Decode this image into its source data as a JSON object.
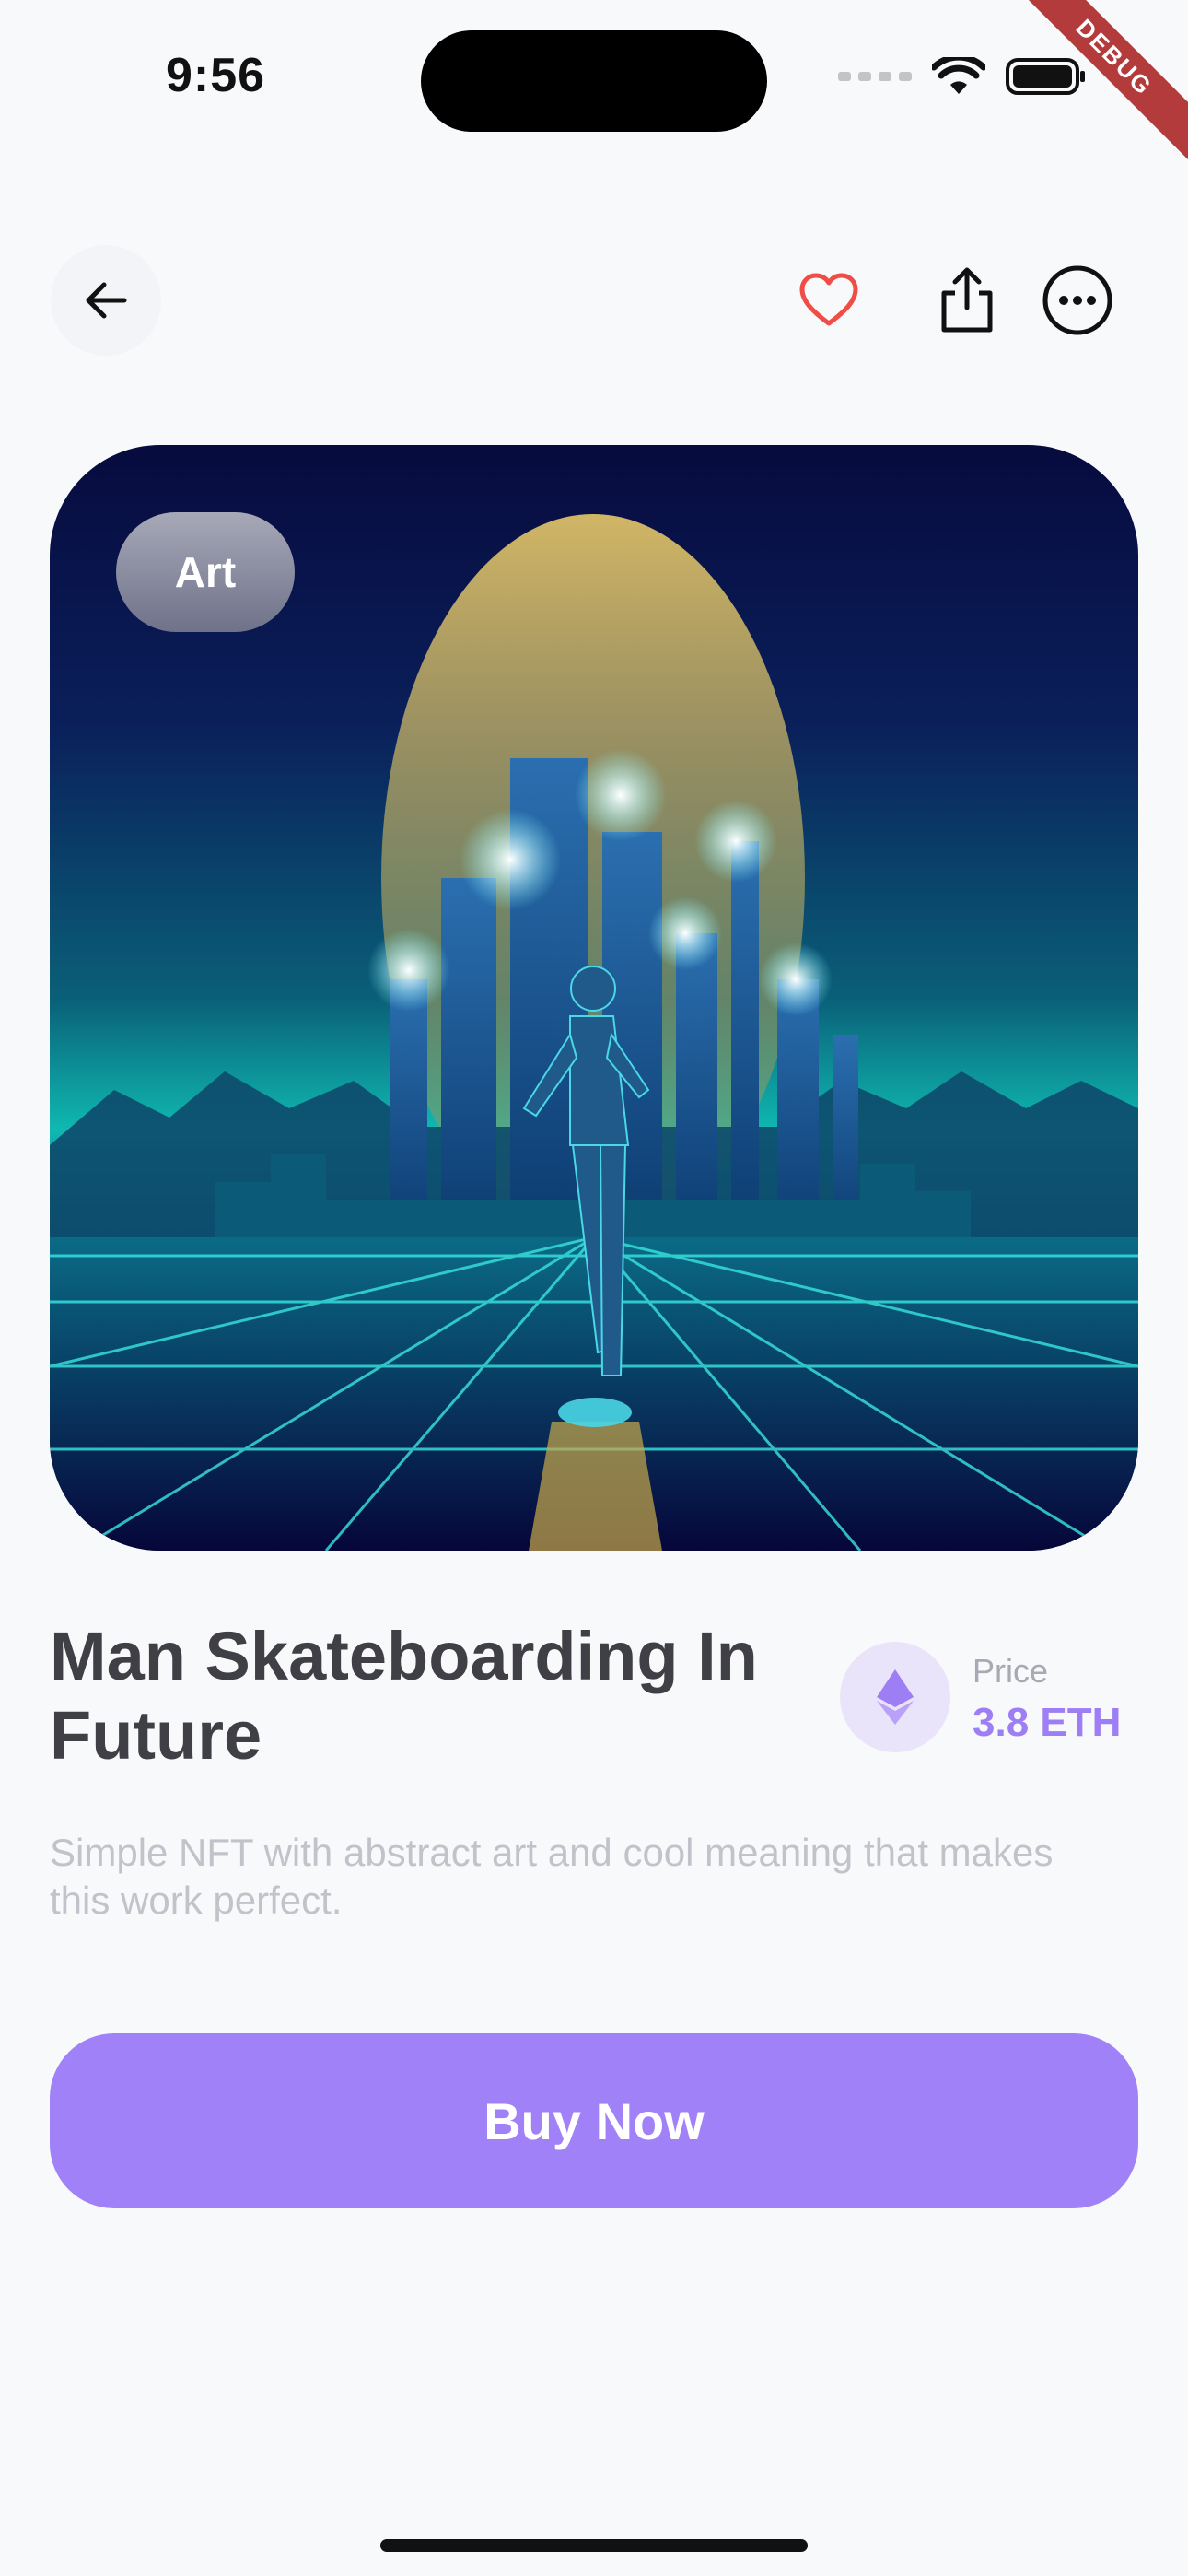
{
  "status_bar": {
    "time": "9:56",
    "debug_label": "DEBUG"
  },
  "nft": {
    "category": "Art",
    "title": "Man Skateboarding In Future",
    "description": "Simple NFT with abstract art and cool meaning that makes this work perfect.",
    "price_label": "Price",
    "price_value": "3.8 ETH"
  },
  "actions": {
    "buy_label": "Buy Now"
  },
  "icons": {
    "back": "arrow-left-icon",
    "favorite": "heart-icon",
    "share": "share-icon",
    "more": "more-icon",
    "currency": "ethereum-icon"
  },
  "colors": {
    "accent": "#a181f7",
    "price": "#9d7ef5",
    "heart": "#ef4d45"
  }
}
